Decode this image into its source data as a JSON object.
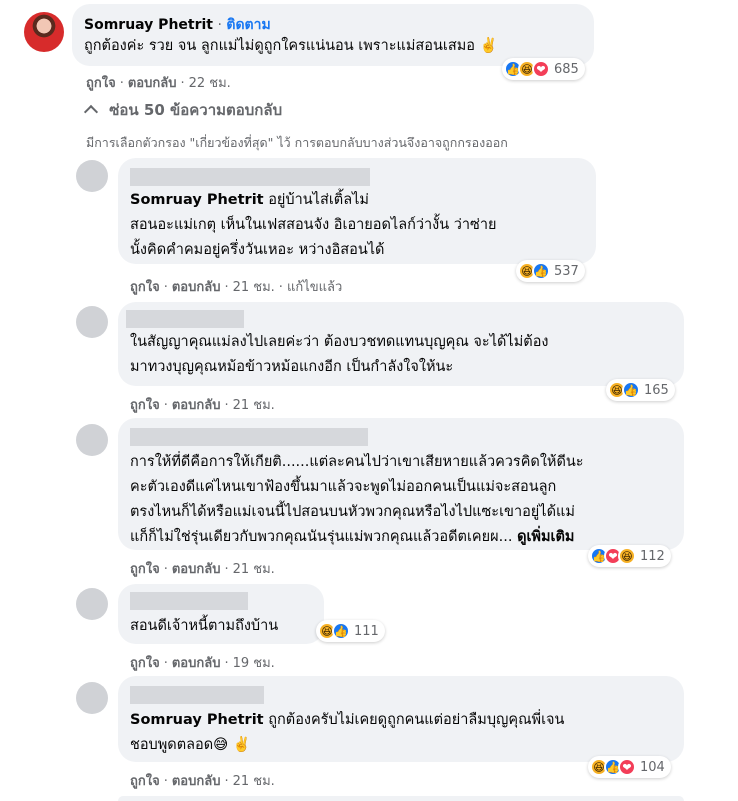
{
  "main_comment": {
    "author": "Somruay Phetrit",
    "follow": "ติดตาม",
    "text": "ถูกต้องค่ะ รวย จน ลูกแม่ไม่ดูถูกใครแน่นอน เพราะแม่สอนเสมอ ✌️",
    "like": "ถูกใจ",
    "reply": "ตอบกลับ",
    "time": "22 ชม.",
    "reaction_count": "685"
  },
  "hide_replies": "ซ่อน 50 ข้อความตอบกลับ",
  "filter_note": "มีการเลือกตัวกรอง \"เกี่ยวข้องที่สุด\" ไว้ การตอบกลับบางส่วนจึงอาจถูกกรองออก",
  "replies": [
    {
      "mention": "Somruay Phetrit",
      "lines": [
        "อยู่บ้านไส่เติ้ลไม่",
        "สอนอะแม่เกตุ เห็นในเฟสสอนจัง อิเอายอดไลก์ว่างั้น ว่าซ่าย",
        "นั้งคิดคำคมอยู่ครึ่งวันเหอะ หว่างอิสอนได้"
      ],
      "like": "ถูกใจ",
      "reply": "ตอบกลับ",
      "time": "21 ชม.",
      "edited": "แก้ไขแล้ว",
      "reaction_count": "537"
    },
    {
      "lines": [
        "ในสัญญาคุณแม่ลงไปเลยค่ะว่า ต้องบวชทดแทนบุญคุณ จะได้ไม่ต้อง",
        "มาทวงบุญคุณหม้อข้าวหม้อแกงอีก เป็นกำลังใจให้นะ"
      ],
      "like": "ถูกใจ",
      "reply": "ตอบกลับ",
      "time": "21 ชม.",
      "reaction_count": "165"
    },
    {
      "lines": [
        "การให้ที่ดีคือการให้เกียติ......แต่ละคนไปว่าเขาเสียหายแล้วควรคิดให้ดีนะ",
        "คะตัวเองดีแค่ไหนเขาฟ้องขึ้นมาแล้วจะพูดไม่ออกคนเป็นแม่จะสอนลูก",
        "ตรงไหนก็ได้หรือแม่เจนนี้ไปสอนบนหัวพวกคุณหรือไงไปแซะเขาอยู่ได้แม่",
        "แก็ก็ไม่ใช่รุ่นเดียวกับพวกคุณนันรุ่นแม่พวกคุณแล้วอดีตเคยผ..."
      ],
      "see_more": "ดูเพิ่มเติม",
      "like": "ถูกใจ",
      "reply": "ตอบกลับ",
      "time": "21 ชม.",
      "reaction_count": "112"
    },
    {
      "lines": [
        "สอนดีเจ้าหนี้ตามถึงบ้าน"
      ],
      "like": "ถูกใจ",
      "reply": "ตอบกลับ",
      "time": "19 ชม.",
      "reaction_count": "111"
    },
    {
      "mention": "Somruay Phetrit",
      "lines": [
        "ถูกต้องครับไม่เคยดูถูกคนแต่อย่าลืมบุญคุณพี่เจน",
        "ชอบพูดตลอด😅 ✌️"
      ],
      "like": "ถูกใจ",
      "reply": "ตอบกลับ",
      "time": "21 ชม.",
      "reaction_count": "104"
    }
  ],
  "icons": {
    "like": "👍",
    "haha": "😆",
    "love": "❤"
  },
  "colors": {
    "bubble": "#f0f2f5",
    "meta": "#65676b",
    "link": "#1877f2"
  }
}
